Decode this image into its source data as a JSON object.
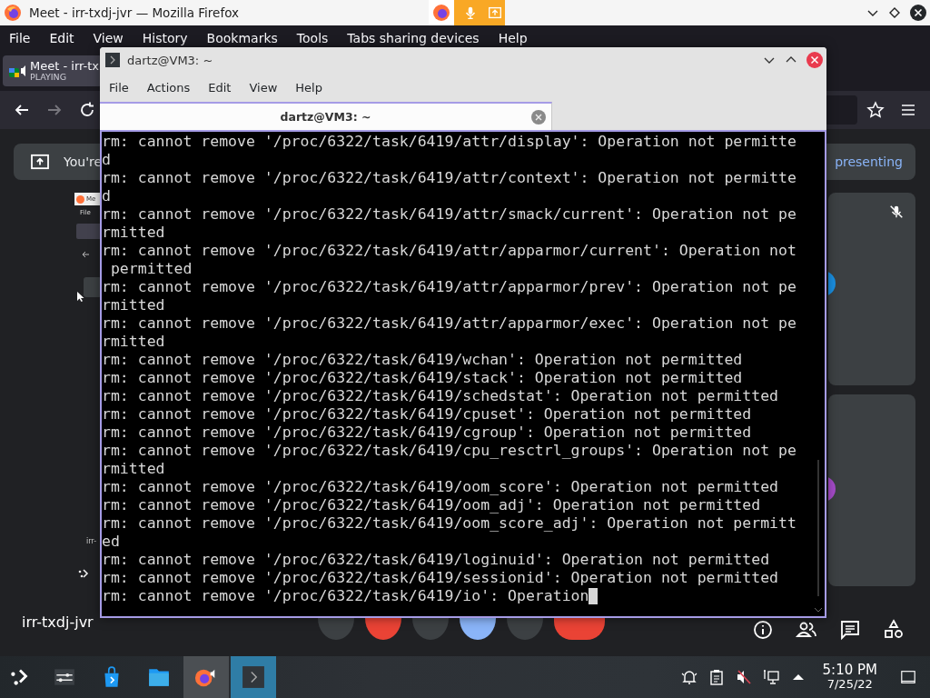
{
  "firefox": {
    "title": "Meet - irr-txdj-jvr — Mozilla Firefox",
    "sharing": [
      {
        "kind": "browser"
      },
      {
        "kind": "mic"
      },
      {
        "kind": "screen"
      }
    ],
    "menu": [
      "File",
      "Edit",
      "View",
      "History",
      "Bookmarks",
      "Tools",
      "Tabs sharing devices",
      "Help"
    ],
    "tab": {
      "title": "Meet - irr-tx",
      "status": "PLAYING",
      "selected": true
    },
    "nav": [
      {
        "kind": "back",
        "disabled": false
      },
      {
        "kind": "forward",
        "disabled": true
      },
      {
        "kind": "reload",
        "disabled": false
      }
    ]
  },
  "meet": {
    "banner": {
      "text": "You're",
      "action": "presenting"
    },
    "preview": {
      "labels": [
        "Me",
        "File",
        "irr-"
      ]
    },
    "participants": [
      {
        "muted": true,
        "color": "#1a8ee0"
      },
      {
        "muted": false,
        "color": "#a54bc9"
      }
    ],
    "meeting_code": "irr-txdj-jvr",
    "controls": [
      {
        "kind": "mic"
      },
      {
        "kind": "camera-off"
      },
      {
        "kind": "captions"
      },
      {
        "kind": "present"
      },
      {
        "kind": "more"
      },
      {
        "kind": "end-call"
      }
    ],
    "side": [
      {
        "kind": "info"
      },
      {
        "kind": "people"
      },
      {
        "kind": "chat"
      },
      {
        "kind": "activities"
      }
    ]
  },
  "terminal": {
    "title": "dartz@VM3: ~",
    "menu": [
      "File",
      "Actions",
      "Edit",
      "View",
      "Help"
    ],
    "tab": {
      "title": "dartz@VM3: ~",
      "selected": true
    },
    "lines": [
      "rm: cannot remove '/proc/6322/task/6419/attr/display': Operation not permitte",
      "d",
      "rm: cannot remove '/proc/6322/task/6419/attr/context': Operation not permitte",
      "d",
      "rm: cannot remove '/proc/6322/task/6419/attr/smack/current': Operation not pe",
      "rmitted",
      "rm: cannot remove '/proc/6322/task/6419/attr/apparmor/current': Operation not",
      " permitted",
      "rm: cannot remove '/proc/6322/task/6419/attr/apparmor/prev': Operation not pe",
      "rmitted",
      "rm: cannot remove '/proc/6322/task/6419/attr/apparmor/exec': Operation not pe",
      "rmitted",
      "rm: cannot remove '/proc/6322/task/6419/wchan': Operation not permitted",
      "rm: cannot remove '/proc/6322/task/6419/stack': Operation not permitted",
      "rm: cannot remove '/proc/6322/task/6419/schedstat': Operation not permitted",
      "rm: cannot remove '/proc/6322/task/6419/cpuset': Operation not permitted",
      "rm: cannot remove '/proc/6322/task/6419/cgroup': Operation not permitted",
      "rm: cannot remove '/proc/6322/task/6419/cpu_resctrl_groups': Operation not pe",
      "rmitted",
      "rm: cannot remove '/proc/6322/task/6419/oom_score': Operation not permitted",
      "rm: cannot remove '/proc/6322/task/6419/oom_adj': Operation not permitted",
      "rm: cannot remove '/proc/6322/task/6419/oom_score_adj': Operation not permitt",
      "ed",
      "rm: cannot remove '/proc/6322/task/6419/loginuid': Operation not permitted",
      "rm: cannot remove '/proc/6322/task/6419/sessionid': Operation not permitted",
      "rm: cannot remove '/proc/6322/task/6419/io': Operation"
    ]
  },
  "taskbar": {
    "apps": [
      {
        "kind": "launcher",
        "running": false,
        "selected": false
      },
      {
        "kind": "settings",
        "running": false,
        "selected": false
      },
      {
        "kind": "store",
        "running": false,
        "selected": false
      },
      {
        "kind": "files",
        "running": false,
        "selected": false
      },
      {
        "kind": "firefox",
        "running": true,
        "selected": false
      },
      {
        "kind": "terminal",
        "running": true,
        "selected": true
      }
    ],
    "tray": [
      {
        "kind": "notifications"
      },
      {
        "kind": "clipboard"
      },
      {
        "kind": "volume",
        "muted": true
      },
      {
        "kind": "network"
      },
      {
        "kind": "expand"
      }
    ],
    "time": "5:10 PM",
    "date": "7/25/22"
  }
}
